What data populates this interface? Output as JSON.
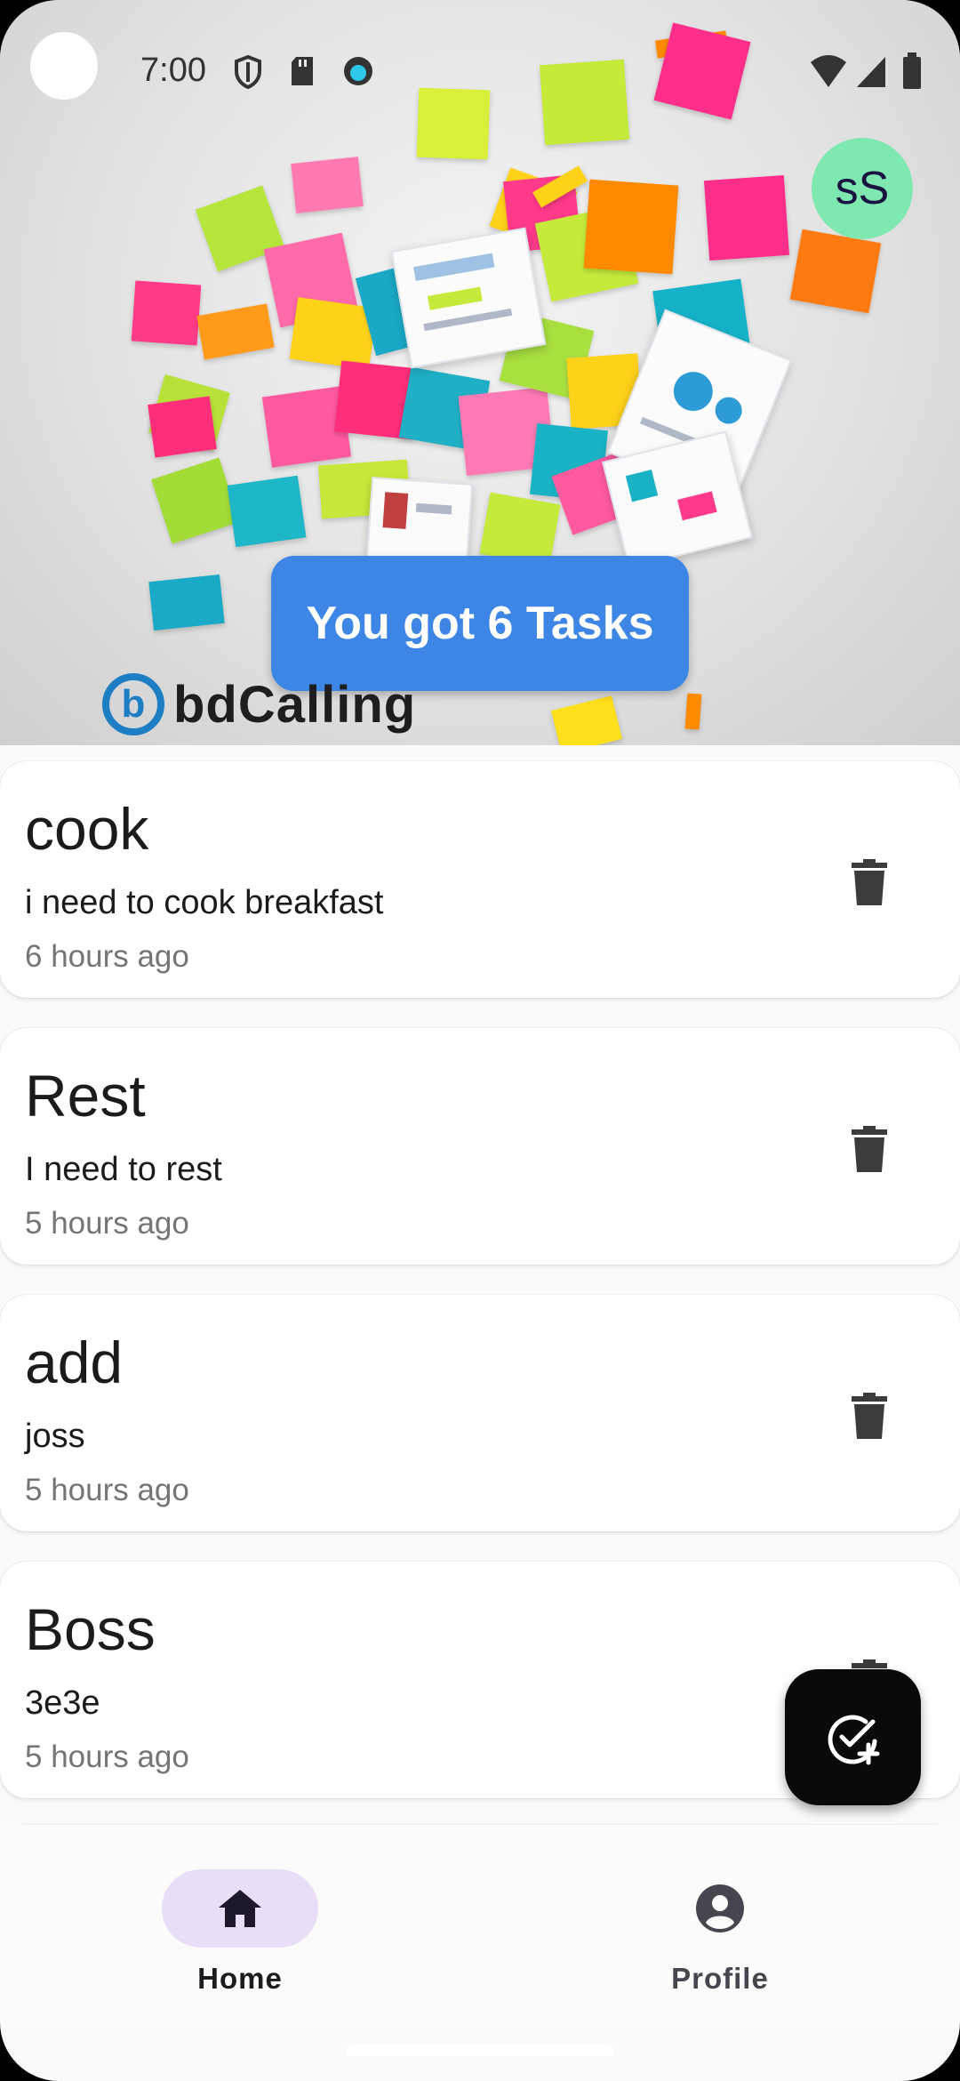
{
  "status_bar": {
    "time": "7:00"
  },
  "header": {
    "avatar_initials": "sS",
    "task_count_label": "You got 6 Tasks",
    "brand_name": "bdCalling",
    "brand_letter": "b"
  },
  "tasks": [
    {
      "title": "cook",
      "description": "i need to cook breakfast",
      "time": "6 hours ago"
    },
    {
      "title": "Rest",
      "description": "I need to rest",
      "time": "5 hours ago"
    },
    {
      "title": "add",
      "description": "joss",
      "time": "5 hours ago"
    },
    {
      "title": "Boss",
      "description": "3e3e",
      "time": "5 hours ago"
    }
  ],
  "nav": {
    "items": [
      {
        "label": "Home",
        "icon": "home-icon",
        "selected": true
      },
      {
        "label": "Profile",
        "icon": "account-circle-icon",
        "selected": false
      }
    ]
  },
  "colors": {
    "accent_pill": "#3d86e6",
    "avatar_bg": "#7ee8b0",
    "nav_selected_bg": "#e8def8",
    "fab_bg": "#0a0a0a"
  }
}
